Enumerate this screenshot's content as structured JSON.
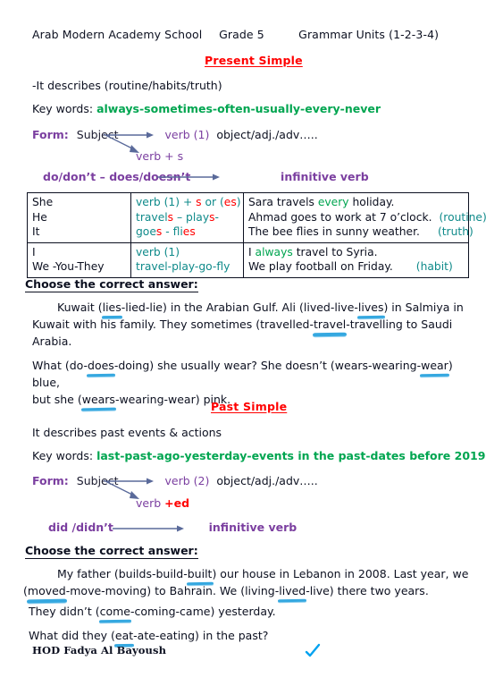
{
  "header": {
    "school": "Arab Modern Academy School",
    "grade": "Grade 5",
    "units": "Grammar Units (1-2-3-4)"
  },
  "present": {
    "title": "Present Simple",
    "describes": "-It describes (routine/habits/truth)",
    "keywords_label": "Key words:",
    "keywords": "always-sometimes-often-usually-every-never",
    "form": {
      "label": "Form:",
      "subject": "Subject",
      "verb_main": "verb (1)",
      "object": "object/adj./adv…..",
      "verb_branch": "verb + s",
      "aux": "do/don’t – does/doesn’t",
      "aux_result": "infinitive verb"
    },
    "table": [
      {
        "subjects": [
          "She",
          "He",
          "It"
        ],
        "forms": [
          [
            {
              "t": "verb (1) + ",
              "c": "teal"
            },
            {
              "t": "s",
              "c": "red"
            },
            {
              "t": " or (",
              "c": "teal"
            },
            {
              "t": "es",
              "c": "red"
            },
            {
              "t": ")",
              "c": "teal"
            }
          ],
          [
            {
              "t": "travel",
              "c": "teal"
            },
            {
              "t": "s",
              "c": "red"
            },
            {
              "t": " – play",
              "c": "teal"
            },
            {
              "t": "s",
              "c": "red"
            },
            {
              "t": "-",
              "c": "teal"
            }
          ],
          [
            {
              "t": "goe",
              "c": "teal"
            },
            {
              "t": "s",
              "c": "red"
            },
            {
              "t": " - fli",
              "c": "teal"
            },
            {
              "t": "es",
              "c": "red"
            }
          ]
        ],
        "examples": [
          {
            "before": "Sara travels ",
            "hl": "every",
            "after": " holiday.",
            "tag": ""
          },
          {
            "before": "Ahmad goes to work at 7 o’clock.",
            "hl": "",
            "after": "",
            "tag": "(routine)"
          },
          {
            "before": "The bee flies in sunny weather.",
            "hl": "",
            "after": "",
            "tag": "(truth)"
          }
        ]
      },
      {
        "subjects": [
          "I",
          "We -You-They"
        ],
        "forms": [
          [
            {
              "t": "verb (1)",
              "c": "teal"
            }
          ],
          [
            {
              "t": "travel-play-go-fly",
              "c": "teal"
            }
          ]
        ],
        "examples": [
          {
            "before": "I ",
            "hl": "always",
            "after": " travel to Syria.",
            "tag": ""
          },
          {
            "before": "We play football on Friday.",
            "hl": "",
            "after": "",
            "tag": "(habit)"
          }
        ]
      }
    ],
    "exercise": {
      "heading": "Choose the correct answer:",
      "p1_line1_a": "Kuwait (",
      "p1_mark1": "lies",
      "p1_line1_b": "-lied-lie) in the Arabian Gulf. Ali (lived-live-",
      "p1_mark2": "lives",
      "p1_line1_c": ") in Salmiya in",
      "p1_line2_a": "Kuwait with his family. They sometimes (travelled-",
      "p1_mark3": "travel",
      "p1_line2_b": "-travelling to Saudi",
      "p1_line3": "Arabia.",
      "p2_line1_a": "What (do-",
      "p2_mark1": "does",
      "p2_line1_b": "-doing) she usually wear? She doesn’t (wears-wearing-",
      "p2_mark2": "wear",
      "p2_line1_c": ") blue,",
      "p2_line2_a": "but she (",
      "p2_mark3": "wears",
      "p2_line2_b": "-wearing-wear) pink."
    }
  },
  "past": {
    "title": "Past Simple",
    "describes": "It describes past events & actions",
    "keywords_label": "Key words:",
    "keywords": "last-past-ago-yesterday-events in the past-dates before 2019",
    "form": {
      "label": "Form:",
      "subject": "Subject",
      "verb_main": "verb (2)",
      "object": "object/adj./adv…..",
      "verb_branch_base": "verb ",
      "verb_branch_suffix": "+ed",
      "aux": "did /didn’t",
      "aux_result": "infinitive verb"
    },
    "exercise": {
      "heading": "Choose the correct answer:",
      "p1_line1_a": "My father (builds-build-",
      "p1_mark1": "built",
      "p1_line1_b": ") our house in Lebanon in 2008. Last year, we",
      "p1_line2_a": "(",
      "p1_mark2": "moved",
      "p1_line2_b": "-move-moving) to Bahrain. We (living-",
      "p1_mark3": "lived",
      "p1_line2_c": "-live) there two years.",
      "p2_a": "They didn’t (",
      "p2_mark": "come",
      "p2_b": "-coming-came) yesterday.",
      "p3_a": "What did they (",
      "p3_mark": "eat",
      "p3_b": "-ate-eating) in the past?"
    }
  },
  "footer": {
    "signature": "HOD Fadya Al Bayoush"
  },
  "colors": {
    "heading_red": "#ff0000",
    "keywords_green": "#00a550",
    "form_purple": "#7b3fa0",
    "table_teal": "#0f8a8a",
    "pen_blue": "#35a8e0",
    "arrow_blue": "#5a6a9a",
    "body_ink": "#0c1020"
  }
}
